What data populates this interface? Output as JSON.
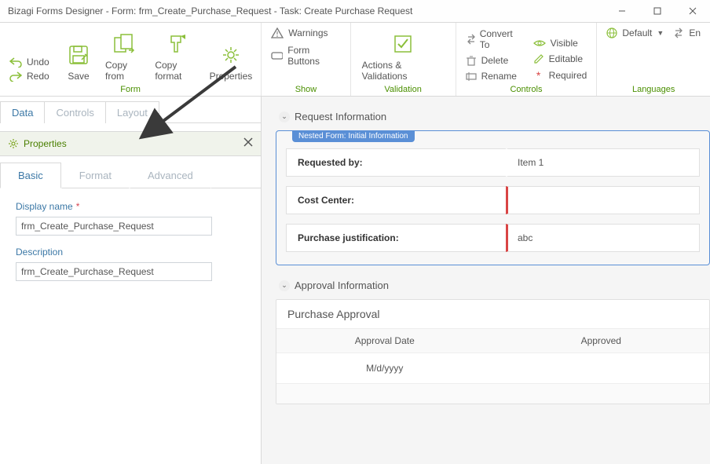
{
  "title": "Bizagi Forms Designer  - Form: frm_Create_Purchase_Request - Task:  Create Purchase Request",
  "ribbon": {
    "undo": "Undo",
    "redo": "Redo",
    "save": "Save",
    "copy_from": "Copy from",
    "copy_format": "Copy format",
    "properties": "Properties",
    "warnings": "Warnings",
    "form_buttons": "Form Buttons",
    "actions_validations": "Actions & Validations",
    "convert_to": "Convert To",
    "delete": "Delete",
    "rename": "Rename",
    "visible": "Visible",
    "editable": "Editable",
    "required": "Required",
    "default": "Default",
    "en": "En",
    "group_form": "Form",
    "group_show": "Show",
    "group_validation": "Validation",
    "group_controls": "Controls",
    "group_languages": "Languages"
  },
  "left_tabs": {
    "data": "Data",
    "controls": "Controls",
    "layout": "Layout"
  },
  "properties": {
    "header": "Properties",
    "tabs": {
      "basic": "Basic",
      "format": "Format",
      "advanced": "Advanced"
    },
    "display_name_label": "Display name",
    "display_name_value": "frm_Create_Purchase_Request",
    "description_label": "Description",
    "description_value": "frm_Create_Purchase_Request"
  },
  "sections": {
    "request_info": "Request Information",
    "approval_info": "Approval Information"
  },
  "nested_form_tag": "Nested Form: Initial Information",
  "fields": {
    "requested_by_label": "Requested by:",
    "requested_by_value": "Item 1",
    "cost_center_label": "Cost Center:",
    "cost_center_value": "",
    "purchase_just_label": "Purchase justification:",
    "purchase_just_value": "abc"
  },
  "grid": {
    "title": "Purchase Approval",
    "col1": "Approval Date",
    "col2": "Approved",
    "row1_col1": "M/d/yyyy",
    "row1_col2": ""
  }
}
